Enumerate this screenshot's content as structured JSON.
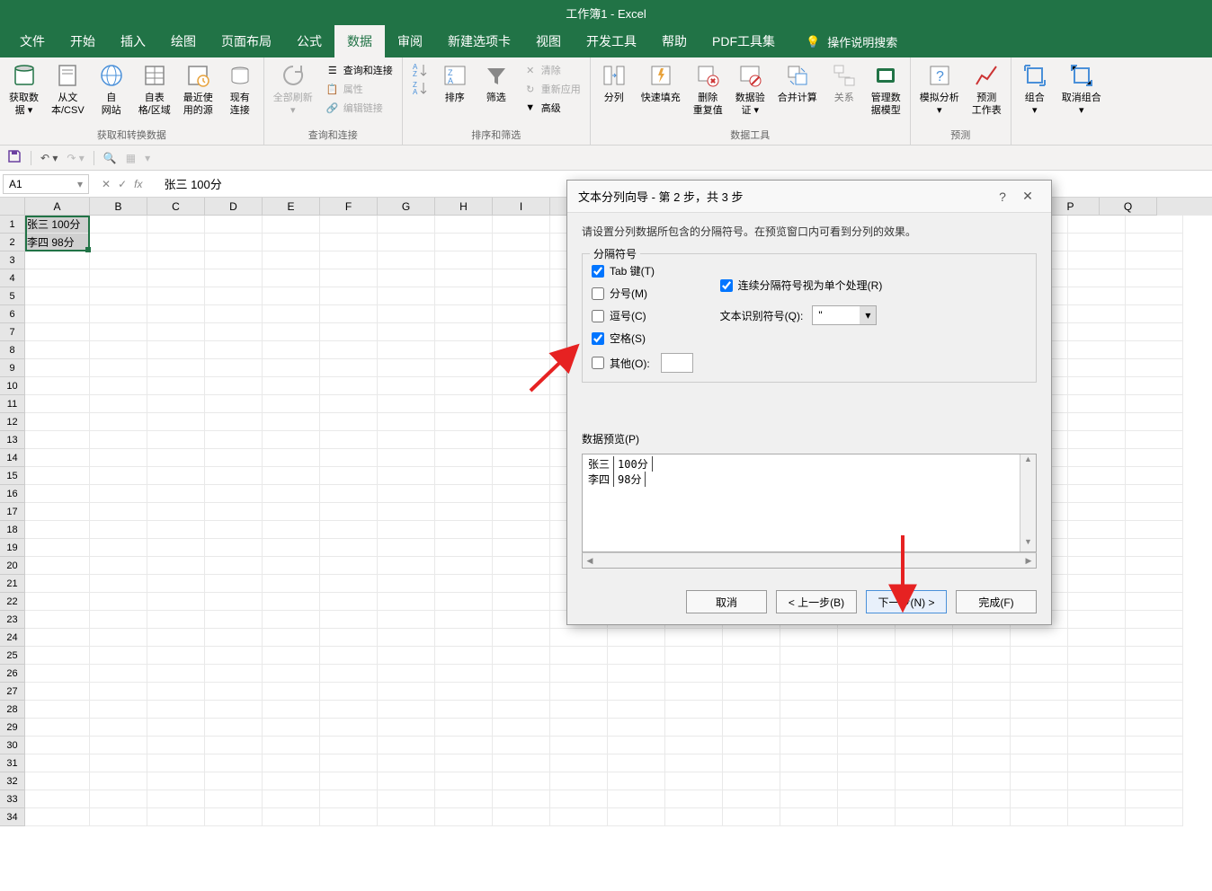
{
  "title_bar": "工作簿1 - Excel",
  "tabs": {
    "file": "文件",
    "home": "开始",
    "insert": "插入",
    "draw": "绘图",
    "layout": "页面布局",
    "formulas": "公式",
    "data": "数据",
    "review": "审阅",
    "newtab": "新建选项卡",
    "view": "视图",
    "developer": "开发工具",
    "help": "帮助",
    "pdf": "PDF工具集",
    "tellme": "操作说明搜索"
  },
  "ribbon": {
    "group1": {
      "btn1": "获取数\n据 ▾",
      "btn2": "从文\n本/CSV",
      "btn3": "自\n网站",
      "btn4": "自表\n格/区域",
      "btn5": "最近使\n用的源",
      "btn6": "现有\n连接",
      "label": "获取和转换数据"
    },
    "group2": {
      "btn1": "全部刷新\n▾",
      "s1": "查询和连接",
      "s2": "属性",
      "s3": "编辑链接",
      "label": "查询和连接"
    },
    "group3": {
      "btn1": "排序",
      "btn2": "筛选",
      "s1": "清除",
      "s2": "重新应用",
      "s3": "高级",
      "label": "排序和筛选"
    },
    "group4": {
      "btn1": "分列",
      "btn2": "快速填充",
      "btn3": "删除\n重复值",
      "btn4": "数据验\n证 ▾",
      "btn5": "合并计算",
      "btn6": "关系",
      "btn7": "管理数\n据模型",
      "label": "数据工具"
    },
    "group5": {
      "btn1": "模拟分析\n▾",
      "btn2": "预测\n工作表",
      "label": "预测"
    },
    "group6": {
      "btn1": "组合\n▾",
      "btn2": "取消组合\n▾"
    }
  },
  "name_box": "A1",
  "formula_value": "张三  100分",
  "cells": {
    "a1": "张三  100分",
    "a2": "李四  98分"
  },
  "col_headers": [
    "A",
    "B",
    "C",
    "D",
    "E",
    "F",
    "G",
    "H",
    "I",
    "P",
    "Q"
  ],
  "dialog": {
    "title": "文本分列向导 - 第 2 步，共 3 步",
    "desc": "请设置分列数据所包含的分隔符号。在预览窗口内可看到分列的效果。",
    "fieldset_label": "分隔符号",
    "tab": "Tab 键(T)",
    "semicolon": "分号(M)",
    "comma": "逗号(C)",
    "space": "空格(S)",
    "other": "其他(O):",
    "consecutive": "连续分隔符号视为单个处理(R)",
    "qualifier_label": "文本识别符号(Q):",
    "qualifier_value": "\"",
    "preview_label": "数据预览(P)",
    "preview": {
      "r1c1": "张三",
      "r1c2": "100分",
      "r2c1": "李四",
      "r2c2": "98分"
    },
    "btn_cancel": "取消",
    "btn_back": "< 上一步(B)",
    "btn_next": "下一步(N) >",
    "btn_finish": "完成(F)"
  }
}
